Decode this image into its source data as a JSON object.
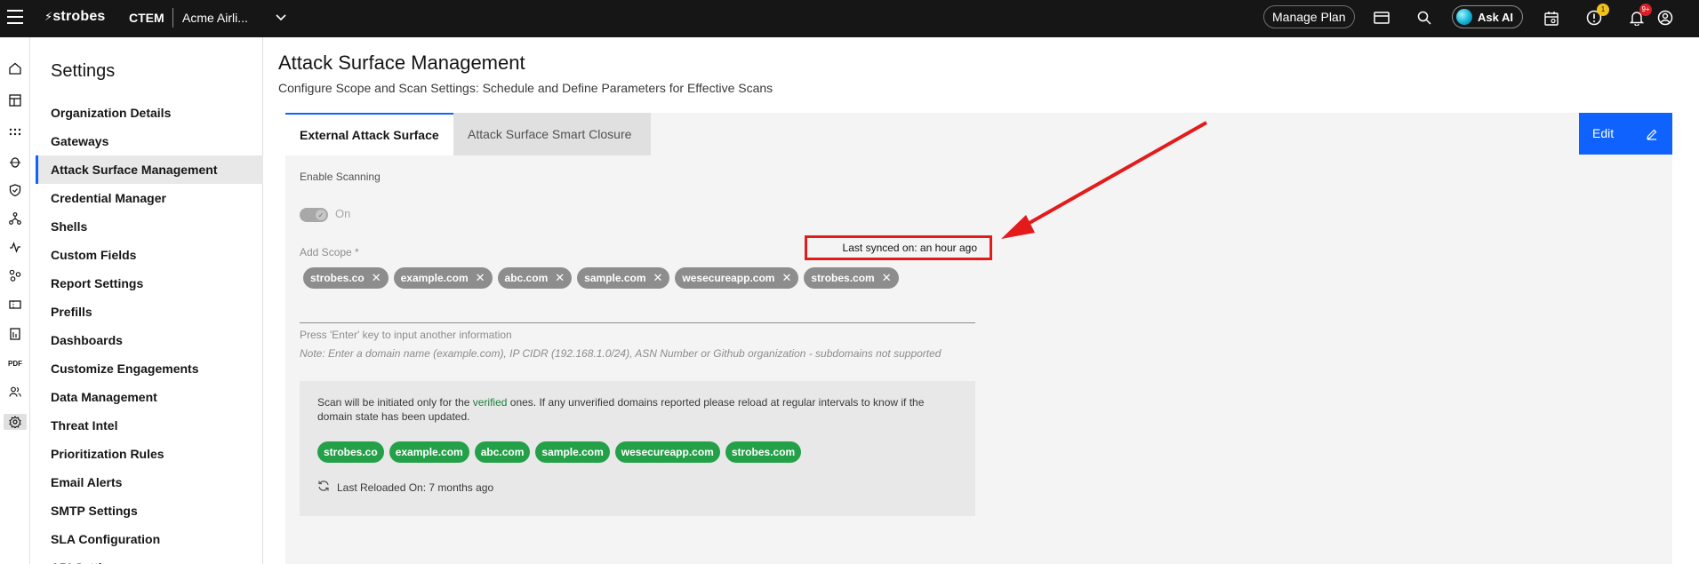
{
  "topbar": {
    "logo": "strobes",
    "product": "CTEM",
    "org": "Acme Airli...",
    "manage_plan": "Manage Plan",
    "ask_ai": "Ask AI",
    "alerts_badge": "1",
    "notifications_badge": "9+",
    "icons": [
      "menu-icon",
      "chevron-down-icon",
      "card-icon",
      "search-icon",
      "calendar-icon",
      "alert-icon",
      "bell-icon",
      "user-icon"
    ]
  },
  "rail": {
    "icons": [
      "home-icon",
      "dashboard-icon",
      "apps-icon",
      "bug-icon",
      "shield-icon",
      "network-icon",
      "activity-icon",
      "integrations-icon",
      "ticket-icon",
      "report-icon",
      "pdf-icon",
      "users-icon",
      "settings-icon"
    ]
  },
  "sidebar": {
    "title": "Settings",
    "items": [
      {
        "label": "Organization Details"
      },
      {
        "label": "Gateways"
      },
      {
        "label": "Attack Surface Management",
        "active": true
      },
      {
        "label": "Credential Manager"
      },
      {
        "label": "Shells"
      },
      {
        "label": "Custom Fields"
      },
      {
        "label": "Report Settings"
      },
      {
        "label": "Prefills"
      },
      {
        "label": "Dashboards"
      },
      {
        "label": "Customize Engagements"
      },
      {
        "label": "Data Management"
      },
      {
        "label": "Threat Intel"
      },
      {
        "label": "Prioritization Rules"
      },
      {
        "label": "Email Alerts"
      },
      {
        "label": "SMTP Settings"
      },
      {
        "label": "SLA Configuration"
      },
      {
        "label": "API Settings"
      }
    ]
  },
  "main": {
    "title": "Attack Surface Management",
    "subtitle": "Configure Scope and Scan Settings: Schedule and Define Parameters for Effective Scans",
    "tabs": [
      {
        "label": "External Attack Surface",
        "active": true
      },
      {
        "label": "Attack Surface Smart Closure"
      }
    ],
    "edit_label": "Edit",
    "enable_scanning_label": "Enable Scanning",
    "toggle_state": "On",
    "add_scope_label": "Add Scope *",
    "last_synced": "Last synced on: an hour ago",
    "scope_tags": [
      "strobes.co",
      "example.com",
      "abc.com",
      "sample.com",
      "wesecureapp.com",
      "strobes.com"
    ],
    "helper": "Press 'Enter' key to input another information",
    "note": "Note: Enter a domain name (example.com), IP CIDR (192.168.1.0/24), ASN Number or Github organization - subdomains not supported",
    "info_prefix": "Scan will be initiated only for the ",
    "info_verified": "verified",
    "info_suffix": " ones. If any unverified domains reported please reload at regular intervals to know if the domain state has been updated.",
    "verified_tags": [
      "strobes.co",
      "example.com",
      "abc.com",
      "sample.com",
      "wesecureapp.com",
      "strobes.com"
    ],
    "last_reloaded": "Last Reloaded On: 7 months ago"
  },
  "colors": {
    "accent": "#0f62fe",
    "annotation": "#e31b1b",
    "verified_tag": "#24a148",
    "scope_tag": "#8d8d8d"
  }
}
